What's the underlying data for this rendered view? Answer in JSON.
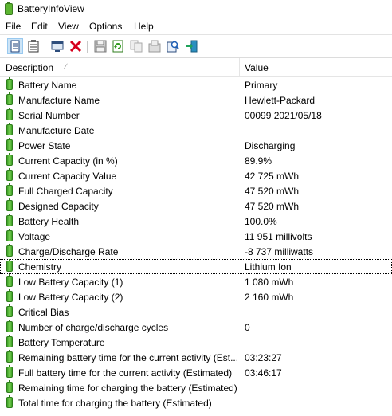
{
  "window": {
    "title": "BatteryInfoView"
  },
  "menu": [
    "File",
    "Edit",
    "View",
    "Options",
    "Help"
  ],
  "toolbar": {
    "buttons": [
      {
        "name": "html-report-icon",
        "active": true
      },
      {
        "name": "properties-icon",
        "active": false
      },
      {
        "name": "computer-icon",
        "active": false
      },
      {
        "name": "delete-icon",
        "active": false
      },
      {
        "name": "save-icon",
        "active": false
      },
      {
        "name": "refresh-icon",
        "active": false
      },
      {
        "name": "copy-icon",
        "active": false
      },
      {
        "name": "options-icon",
        "active": false
      },
      {
        "name": "find-icon",
        "active": false
      },
      {
        "name": "exit-icon",
        "active": false
      }
    ]
  },
  "columns": {
    "description": "Description",
    "value": "Value"
  },
  "rows": [
    {
      "description": "Battery Name",
      "value": "Primary"
    },
    {
      "description": "Manufacture Name",
      "value": "Hewlett-Packard"
    },
    {
      "description": "Serial Number",
      "value": "00099 2021/05/18"
    },
    {
      "description": "Manufacture Date",
      "value": ""
    },
    {
      "description": "Power State",
      "value": "Discharging"
    },
    {
      "description": "Current Capacity (in %)",
      "value": "89.9%"
    },
    {
      "description": "Current Capacity Value",
      "value": "42 725 mWh"
    },
    {
      "description": "Full Charged Capacity",
      "value": "47 520 mWh"
    },
    {
      "description": "Designed Capacity",
      "value": "47 520 mWh"
    },
    {
      "description": "Battery Health",
      "value": "100.0%"
    },
    {
      "description": "Voltage",
      "value": "11 951 millivolts"
    },
    {
      "description": "Charge/Discharge Rate",
      "value": "-8 737 milliwatts"
    },
    {
      "description": "Chemistry",
      "value": "Lithium Ion",
      "focused": true
    },
    {
      "description": "Low Battery Capacity (1)",
      "value": "1 080 mWh"
    },
    {
      "description": "Low Battery Capacity (2)",
      "value": "2 160 mWh"
    },
    {
      "description": "Critical Bias",
      "value": ""
    },
    {
      "description": "Number of charge/discharge cycles",
      "value": "0"
    },
    {
      "description": "Battery Temperature",
      "value": ""
    },
    {
      "description": "Remaining battery time for the current activity (Est...",
      "value": "03:23:27"
    },
    {
      "description": "Full battery time for the current activity (Estimated)",
      "value": "03:46:17"
    },
    {
      "description": "Remaining time for charging the battery (Estimated)",
      "value": ""
    },
    {
      "description": "Total  time for charging the battery (Estimated)",
      "value": ""
    }
  ]
}
